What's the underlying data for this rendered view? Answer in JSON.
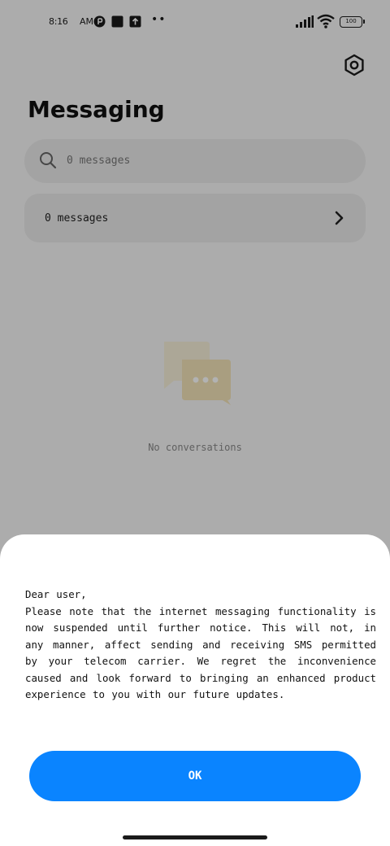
{
  "status_bar": {
    "time": "8:16",
    "ampm": "AM",
    "battery": "100"
  },
  "header": {
    "title": "Messaging",
    "settings_icon": "gear-icon"
  },
  "search": {
    "placeholder": "0 messages"
  },
  "messages_row": {
    "label": "0 messages"
  },
  "empty_state": {
    "text": "No conversations",
    "icon": "chat-bubbles-icon"
  },
  "dialog": {
    "greeting": "Dear user,",
    "body": "Please note that the internet messaging functionality is now suspended until further notice. This will not, in any manner, affect sending and receiving SMS permitted by your telecom carrier. We regret the inconvenience caused and look forward to bringing an enhanced product experience to you with our future updates.",
    "ok_label": "OK"
  },
  "colors": {
    "accent": "#0a84ff",
    "background": "#f6f6f6",
    "scrim": "rgba(0,0,0,0.30)",
    "illustration": "#f2e3b8"
  }
}
